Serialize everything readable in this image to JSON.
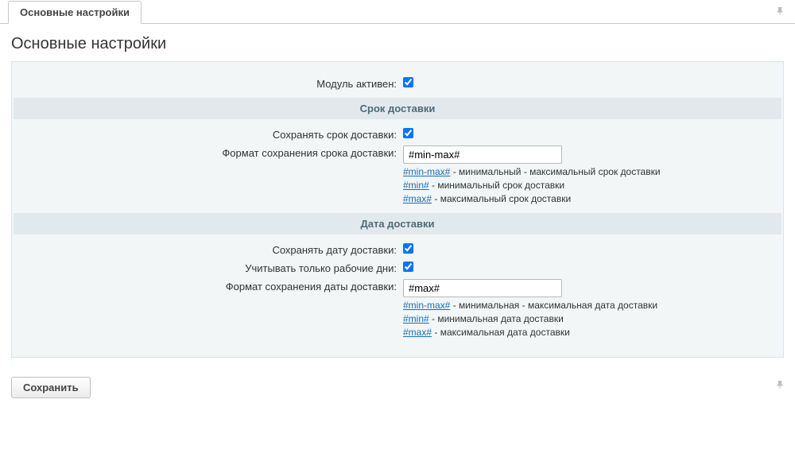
{
  "tab": {
    "label": "Основные настройки"
  },
  "panel": {
    "title": "Основные настройки"
  },
  "fields": {
    "module_active": {
      "label": "Модуль активен:",
      "checked": true
    }
  },
  "section_term": {
    "title": "Срок доставки",
    "save_term": {
      "label": "Сохранять срок доставки:",
      "checked": true
    },
    "format": {
      "label": "Формат сохранения срока доставки:",
      "value": "#min-max#",
      "help": {
        "minmax_link": "#min-max#",
        "minmax_text": " - минимальный - максимальный срок доставки",
        "min_link": "#min#",
        "min_text": " - минимальный срок доставки",
        "max_link": "#max#",
        "max_text": " - максимальный срок доставки"
      }
    }
  },
  "section_date": {
    "title": "Дата доставки",
    "save_date": {
      "label": "Сохранять дату доставки:",
      "checked": true
    },
    "workdays": {
      "label": "Учитывать только рабочие дни:",
      "checked": true
    },
    "format": {
      "label": "Формат сохранения даты доставки:",
      "value": "#max#",
      "help": {
        "minmax_link": "#min-max#",
        "minmax_text": " - минимальная - максимальная дата доставки",
        "min_link": "#min#",
        "min_text": " - минимальная дата доставки",
        "max_link": "#max#",
        "max_text": " - максимальная дата доставки"
      }
    }
  },
  "buttons": {
    "save": "Сохранить"
  }
}
